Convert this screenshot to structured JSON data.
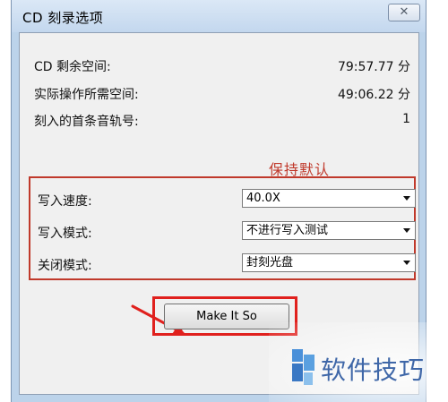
{
  "window": {
    "title": "CD 刻录选项",
    "close_symbol": "✕"
  },
  "info": [
    {
      "label": "CD 剩余空间:",
      "value": "79:57.77 分"
    },
    {
      "label": "实际操作所需空间:",
      "value": "49:06.22 分"
    },
    {
      "label": "刻入的首条音轨号:",
      "value": "1"
    }
  ],
  "annotation": {
    "keep_default": "保持默认",
    "annotation_color": "#c0392b",
    "highlight_color": "#e0201d"
  },
  "options": {
    "write_speed": {
      "label": "写入速度:",
      "value": "40.0X"
    },
    "write_mode": {
      "label": "写入模式:",
      "value": "不进行写入测试"
    },
    "close_mode": {
      "label": "关闭模式:",
      "value": "封刻光盘"
    }
  },
  "actions": {
    "make_it_so": "Make It So"
  },
  "watermark": {
    "text": "软件技巧",
    "color": "#3f67a8"
  }
}
